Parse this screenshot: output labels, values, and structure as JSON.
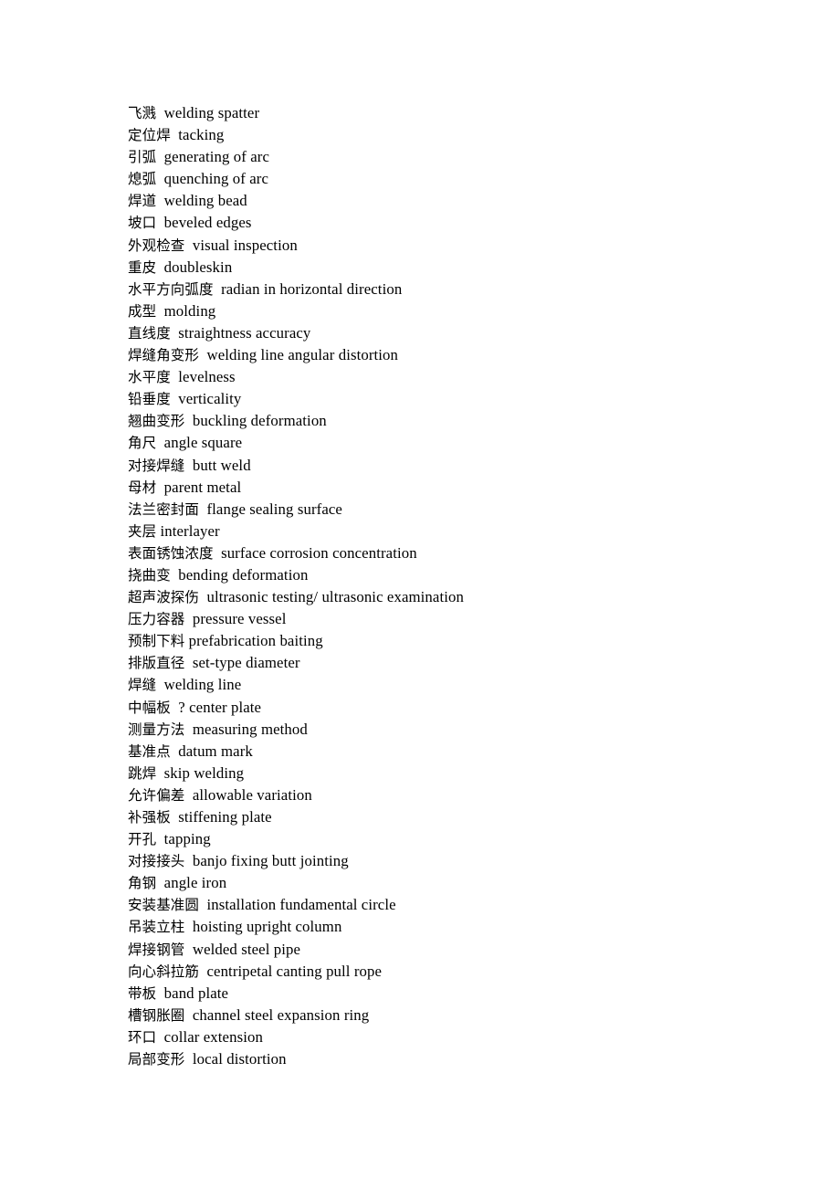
{
  "document": {
    "type": "glossary-list",
    "language_pair": "Chinese-English",
    "background_color": "#ffffff",
    "text_color": "#000000",
    "entry_count": 44,
    "entries": [
      {
        "term": "飞溅",
        "gap": "  ",
        "gloss": "welding spatter"
      },
      {
        "term": "定位焊",
        "gap": "  ",
        "gloss": "tacking"
      },
      {
        "term": "引弧",
        "gap": "  ",
        "gloss": "generating of arc"
      },
      {
        "term": "熄弧",
        "gap": "  ",
        "gloss": "quenching of arc"
      },
      {
        "term": "焊道",
        "gap": "  ",
        "gloss": "welding bead"
      },
      {
        "term": "坡口",
        "gap": "  ",
        "gloss": "beveled edges"
      },
      {
        "term": "外观检查",
        "gap": "  ",
        "gloss": "visual inspection"
      },
      {
        "term": "重皮",
        "gap": "  ",
        "gloss": "doubleskin"
      },
      {
        "term": "水平方向弧度",
        "gap": "  ",
        "gloss": "radian in horizontal direction"
      },
      {
        "term": "成型",
        "gap": "  ",
        "gloss": "molding"
      },
      {
        "term": "直线度",
        "gap": "  ",
        "gloss": "straightness accuracy"
      },
      {
        "term": "焊缝角变形",
        "gap": "  ",
        "gloss": "welding line angular distortion"
      },
      {
        "term": "水平度",
        "gap": "  ",
        "gloss": "levelness"
      },
      {
        "term": "铅垂度",
        "gap": "  ",
        "gloss": "verticality"
      },
      {
        "term": "翘曲变形",
        "gap": "  ",
        "gloss": "buckling deformation"
      },
      {
        "term": "角尺",
        "gap": "  ",
        "gloss": "angle square"
      },
      {
        "term": "对接焊缝",
        "gap": "  ",
        "gloss": "butt weld"
      },
      {
        "term": "母材",
        "gap": "  ",
        "gloss": "parent metal"
      },
      {
        "term": "法兰密封面",
        "gap": "  ",
        "gloss": "flange sealing surface"
      },
      {
        "term": "夹层",
        "gap": " ",
        "gloss": "interlayer"
      },
      {
        "term": "表面锈蚀浓度",
        "gap": "  ",
        "gloss": "surface corrosion concentration"
      },
      {
        "term": "挠曲变",
        "gap": "  ",
        "gloss": "bending deformation"
      },
      {
        "term": "超声波探伤",
        "gap": "  ",
        "gloss": "ultrasonic testing/ ultrasonic examination"
      },
      {
        "term": "压力容器",
        "gap": "  ",
        "gloss": "pressure vessel"
      },
      {
        "term": "预制下料",
        "gap": " ",
        "gloss": "prefabrication baiting"
      },
      {
        "term": "排版直径",
        "gap": "  ",
        "gloss": "set-type diameter"
      },
      {
        "term": "焊缝",
        "gap": "  ",
        "gloss": "welding line"
      },
      {
        "term": "中幅板",
        "gap": "  ",
        "gloss": "? center plate"
      },
      {
        "term": "测量方法",
        "gap": "  ",
        "gloss": "measuring method"
      },
      {
        "term": "基准点",
        "gap": "  ",
        "gloss": "datum mark"
      },
      {
        "term": "跳焊",
        "gap": "  ",
        "gloss": "skip welding"
      },
      {
        "term": "允许偏差",
        "gap": "  ",
        "gloss": "allowable variation"
      },
      {
        "term": "补强板",
        "gap": "  ",
        "gloss": "stiffening plate"
      },
      {
        "term": "开孔",
        "gap": "  ",
        "gloss": "tapping"
      },
      {
        "term": "对接接头",
        "gap": "  ",
        "gloss": "banjo fixing butt jointing"
      },
      {
        "term": "角钢",
        "gap": "  ",
        "gloss": "angle iron"
      },
      {
        "term": "安装基准圆",
        "gap": "  ",
        "gloss": "installation fundamental circle"
      },
      {
        "term": "吊装立柱",
        "gap": "  ",
        "gloss": "hoisting upright column"
      },
      {
        "term": "焊接钢管",
        "gap": "  ",
        "gloss": "welded steel pipe"
      },
      {
        "term": "向心斜拉筋",
        "gap": "  ",
        "gloss": "centripetal canting pull rope"
      },
      {
        "term": "带板",
        "gap": "  ",
        "gloss": "band plate"
      },
      {
        "term": "槽钢胀圈",
        "gap": "  ",
        "gloss": "channel steel expansion ring"
      },
      {
        "term": "环口",
        "gap": "  ",
        "gloss": "collar extension"
      },
      {
        "term": "局部变形",
        "gap": "  ",
        "gloss": "local distortion"
      }
    ]
  }
}
